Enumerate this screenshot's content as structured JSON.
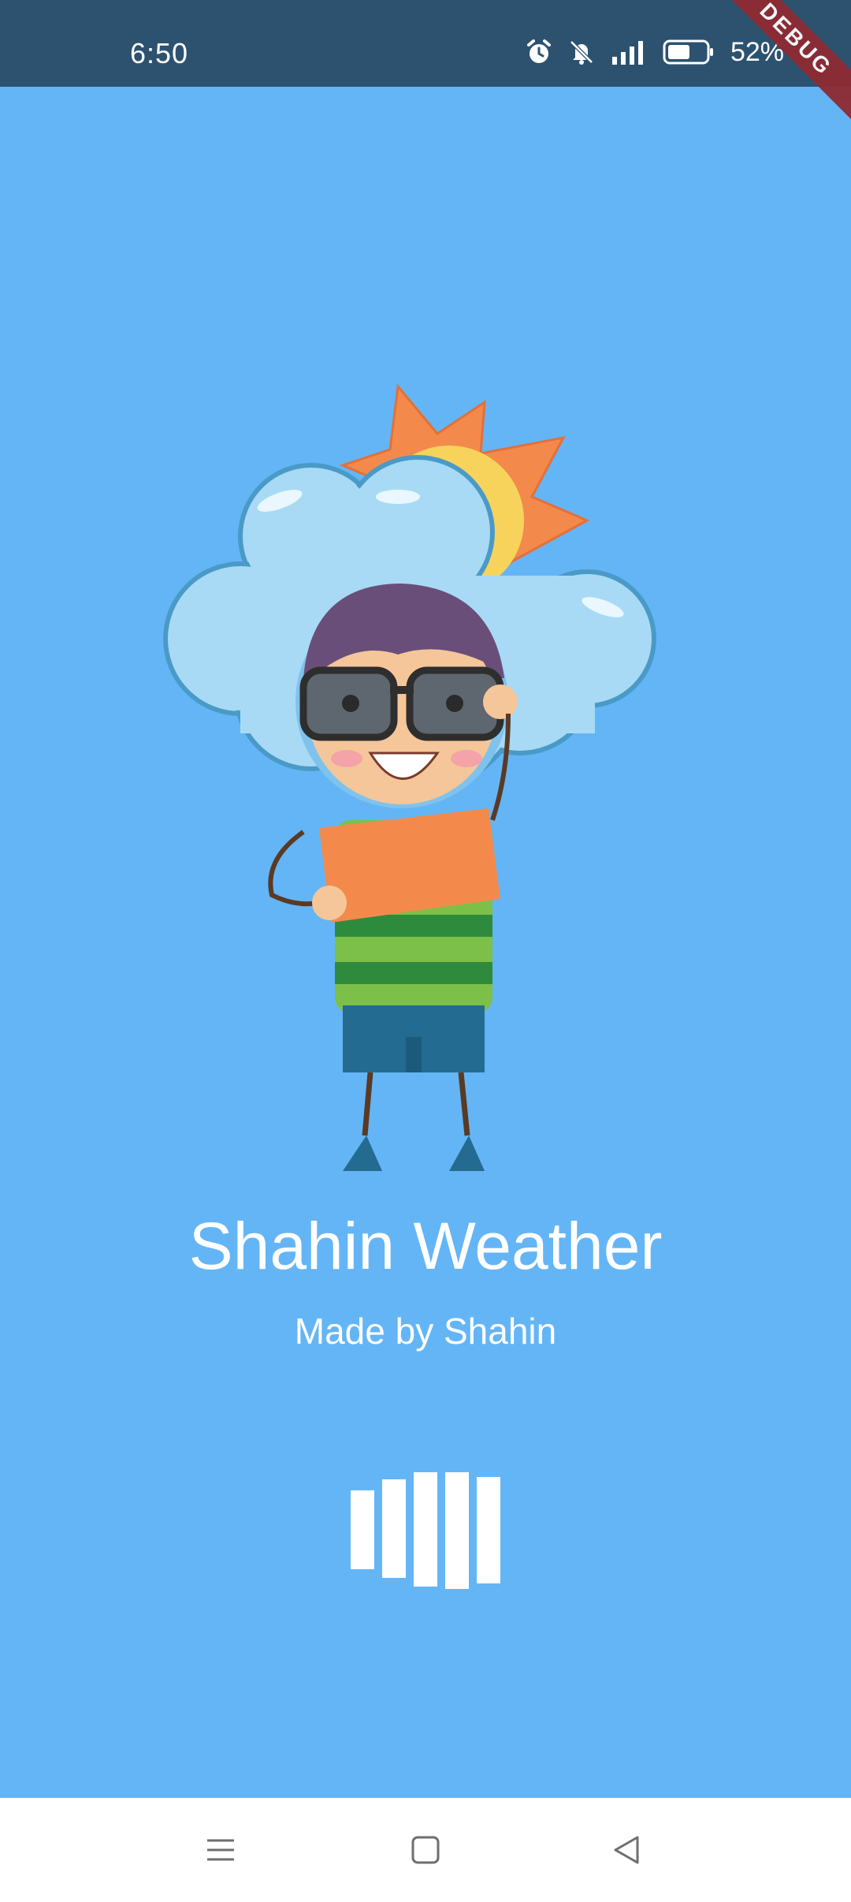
{
  "status_bar": {
    "time": "6:50",
    "battery_percent": "52%",
    "icons": [
      "alarm-icon",
      "bell-muted-icon",
      "signal-icon",
      "battery-icon"
    ],
    "debug_label": "DEBUG"
  },
  "splash": {
    "title": "Shahin Weather",
    "subtitle": "Made by Shahin",
    "illustration": "boy-in-cloud-with-sun-illustration",
    "loader_icon": "bars-loading-indicator"
  },
  "nav_bar": {
    "buttons": [
      "menu-icon",
      "home-icon",
      "back-icon"
    ]
  },
  "colors": {
    "background": "#64B5F6",
    "status_bar": "#2C5270",
    "text": "#FFFFFF",
    "nav_bar": "#FFFFFF"
  }
}
